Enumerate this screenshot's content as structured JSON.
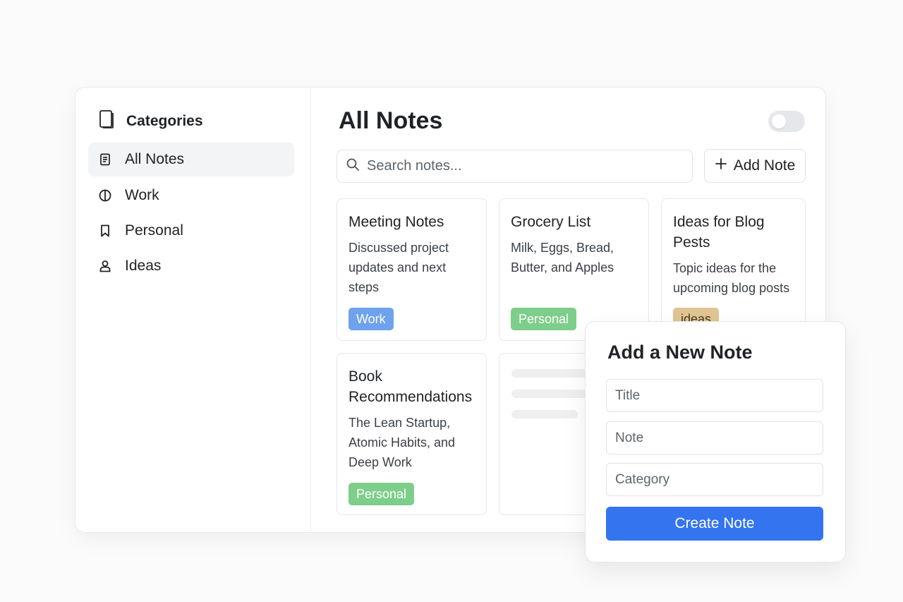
{
  "sidebar": {
    "title": "Categories",
    "items": [
      {
        "label": "All Notes",
        "icon": "note-icon",
        "active": true
      },
      {
        "label": "Work",
        "icon": "half-circle-icon",
        "active": false
      },
      {
        "label": "Personal",
        "icon": "bookmark-icon",
        "active": false
      },
      {
        "label": "Ideas",
        "icon": "person-icon",
        "active": false
      }
    ]
  },
  "main": {
    "title": "All Notes",
    "search_placeholder": "Search notes...",
    "add_note_label": "Add Note",
    "theme_toggle_on": false
  },
  "notes": [
    {
      "title": "Meeting Notes",
      "body": "Discussed project updates and next steps",
      "tag": "Work"
    },
    {
      "title": "Grocery List",
      "body": "Milk, Eggs, Bread, Butter, and Apples",
      "tag": "Personal"
    },
    {
      "title": "Ideas for Blog Pests",
      "body": "Topic ideas for the upcoming blog posts",
      "tag": "ideas"
    },
    {
      "title": "Book Recommendations",
      "body": "The Lean Startup, Atomic Habits, and Deep Work",
      "tag": "Personal"
    }
  ],
  "modal": {
    "title": "Add a New Note",
    "title_placeholder": "Title",
    "note_placeholder": "Note",
    "category_placeholder": "Category",
    "submit_label": "Create Note"
  },
  "colors": {
    "primary": "#3474ee",
    "work_tag": "#6ea2ec",
    "personal_tag": "#7dce8a",
    "ideas_tag": "#e0c491"
  }
}
